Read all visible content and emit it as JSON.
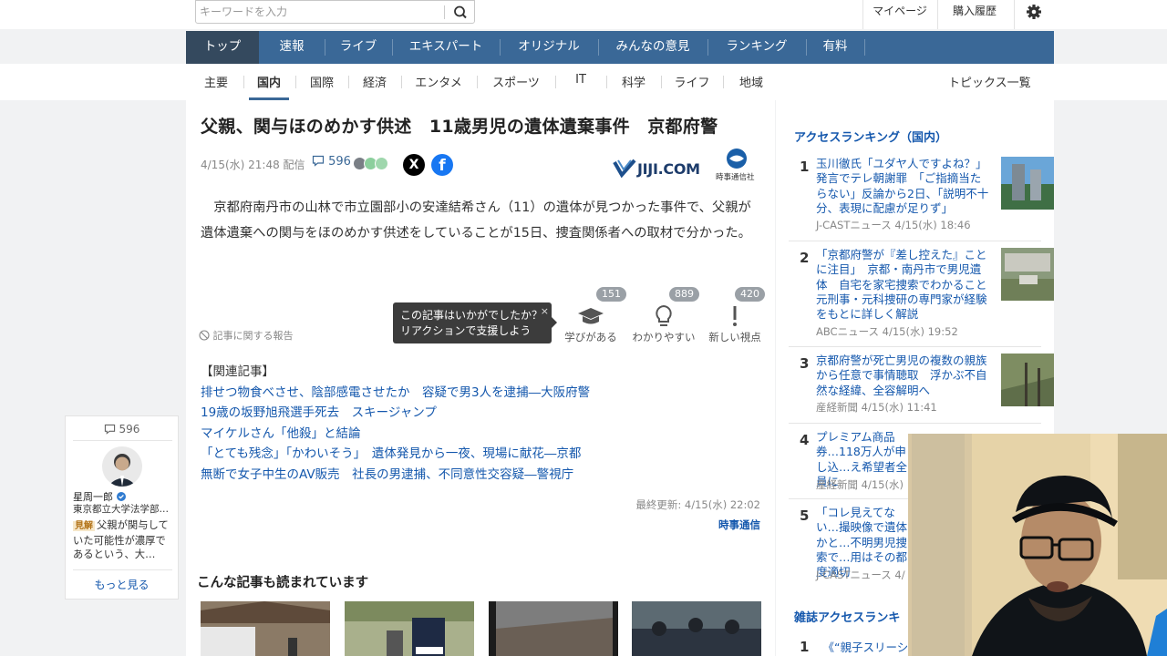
{
  "search": {
    "placeholder": "キーワードを入力"
  },
  "top_links": {
    "mypage": "マイページ",
    "history": "購入履歴"
  },
  "main_nav": [
    "トップ",
    "速報",
    "ライブ",
    "エキスパート",
    "オリジナル",
    "みんなの意見",
    "ランキング",
    "有料"
  ],
  "sub_nav": [
    "主要",
    "国内",
    "国際",
    "経済",
    "エンタメ",
    "スポーツ",
    "IT",
    "科学",
    "ライフ",
    "地域"
  ],
  "topics_label": "トピックス一覧",
  "article": {
    "title": "父親、関与ほのめかす供述　11歳男児の遺体遺棄事件　京都府警",
    "date": "4/15(水) 21:48 配信",
    "comment_count": "596",
    "share_x": "X",
    "share_fb": "f",
    "publisher_logo": "JIJI.COM",
    "publisher_logo_sub": "時事通信社",
    "body": "　京都府南丹市の山林で市立園部小の安達結希さん（11）の遺体が見つかった事件で、父親が遺体遺棄への関与をほのめかす供述をしていることが15日、捜査関係者への取材で分かった。",
    "report_label": "記事に関する報告",
    "tooltip": {
      "line1": "この記事はいかがでしたか？",
      "line2": "リアクションで支援しよう",
      "close": "×"
    },
    "reactions": [
      {
        "count": "151",
        "label": "学びがある",
        "icon": "graduation-cap-icon"
      },
      {
        "count": "889",
        "label": "わかりやすい",
        "icon": "lightbulb-icon"
      },
      {
        "count": "420",
        "label": "新しい視点",
        "icon": "exclamation-icon"
      }
    ],
    "related_heading": "【関連記事】",
    "related": [
      "排せつ物食べさせ、陰部感電させたか　容疑で男3人を逮捕―大阪府警",
      "19歳の坂野旭飛選手死去　スキージャンプ",
      "マイケルさん「他殺」と結論",
      "「とても残念」「かわいそう」　遺体発見から一夜、現場に献花―京都",
      "無断で女子中生のAV販売　社長の男逮捕、不同意性交容疑―警視庁"
    ],
    "updated": "最終更新: 4/15(水) 22:02",
    "source": "時事通信"
  },
  "more_reads": {
    "title": "こんな記事も読まれています"
  },
  "ranking": {
    "title": "アクセスランキング（国内）",
    "items": [
      {
        "num": "1",
        "text": "玉川徹氏「ユダヤ人ですよね？」発言でテレ朝謝罪　「ご指摘当たらない」反論から2日、「説明不十分、表現に配慮が足りず」",
        "src": "J-CASTニュース 4/15(水) 18:46"
      },
      {
        "num": "2",
        "text": "「京都府警が『差し控えた』ことに注目」　京都・南丹市で男児遺体　自宅を家宅捜索でわかること　元刑事・元科捜研の専門家が経験をもとに詳しく解説",
        "src": "ABCニュース 4/15(水) 19:52"
      },
      {
        "num": "3",
        "text": "京都府警が死亡男児の複数の親族から任意で事情聴取　浮かぶ不自然な経緯、全容解明へ",
        "src": "産経新聞 4/15(水) 11:41"
      },
      {
        "num": "4",
        "text": "プレミアム商品券…118万人が申し込…え希望者全員に",
        "src": "産経新聞 4/15(水)"
      },
      {
        "num": "5",
        "text": "「コレ見えてない…撮映像で遺体かと…不明男児捜索で…用はその都度適切",
        "src": "J-CASTニュース 4/"
      }
    ]
  },
  "magazine": {
    "title": "雑誌アクセスランキ",
    "first_num": "1",
    "first_text": "《“親子スリーシ…"
  },
  "comment_box": {
    "count": "596",
    "name": "星周一郎",
    "role": "東京都立大学法学部…",
    "badge": "見解",
    "text": "父親が関与していた可能性が濃厚であるという、大…",
    "more": "もっと見る"
  }
}
